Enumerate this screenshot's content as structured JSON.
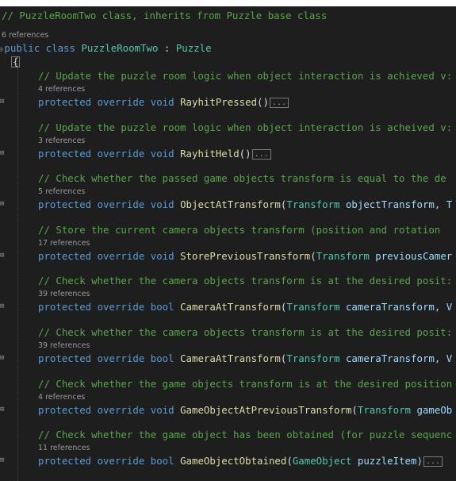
{
  "class_header": {
    "comment": "// PuzzleRoomTwo class, inherits from Puzzle base class",
    "refs": "6 references",
    "kw_public": "public",
    "kw_class": "class",
    "class_name": "PuzzleRoomTwo",
    "colon": " : ",
    "base_class": "Puzzle",
    "open_brace": "{"
  },
  "collapsed_marker": "...",
  "members": [
    {
      "comment": "// Update the puzzle room logic when object interaction is achieved v:",
      "refs": "4 references",
      "modifiers": "protected override",
      "return_type": "void",
      "name": "RayhitPressed",
      "signature_rest": "()",
      "param_type": "",
      "param_name": ""
    },
    {
      "comment": "// Update the puzzle room logic when object interaction is acheived v:",
      "refs": "3 references",
      "modifiers": "protected override",
      "return_type": "void",
      "name": "RayhitHeld",
      "signature_rest": "()",
      "param_type": "",
      "param_name": ""
    },
    {
      "comment": "// Check whether the passed game objects transform is equal to the de",
      "refs": "5 references",
      "modifiers": "protected override",
      "return_type": "void",
      "name": "ObjectAtTransform",
      "signature_rest": "(",
      "param_type": "Transform",
      "param_name": "objectTransform, T"
    },
    {
      "comment": "// Store the current camera objects transform (position and rotation",
      "refs": "17 references",
      "modifiers": "protected override",
      "return_type": "void",
      "name": "StorePreviousTransform",
      "signature_rest": "(",
      "param_type": "Transform",
      "param_name": "previousCamer"
    },
    {
      "comment": "// Check whether the camera objects transform is at the desired posit:",
      "refs": "39 references",
      "modifiers": "protected override",
      "return_type": "bool",
      "name": "CameraAtTransform",
      "signature_rest": "(",
      "param_type": "Transform",
      "param_name": "cameraTransform, V"
    },
    {
      "comment": "// Check whether the camera objects transform is at the desired posit:",
      "refs": "39 references",
      "modifiers": "protected override",
      "return_type": "bool",
      "name": "CameraAtTransform",
      "signature_rest": "(",
      "param_type": "Transform",
      "param_name": "cameraTransform, V"
    },
    {
      "comment": "// Check whether the game objects transform is at the desired position",
      "refs": "4 references",
      "modifiers": "protected override",
      "return_type": "void",
      "name": "GameObjectAtPreviousTransform",
      "signature_rest": "(",
      "param_type": "Transform",
      "param_name": "gameOb"
    },
    {
      "comment": "// Check whether the game object has been obtained (for puzzle sequenc",
      "refs": "11 references",
      "modifiers": "protected override",
      "return_type": "bool",
      "name": "GameObjectObtained",
      "signature_rest": "(",
      "param_type": "GameObject",
      "param_name": "puzzleItem)"
    }
  ]
}
